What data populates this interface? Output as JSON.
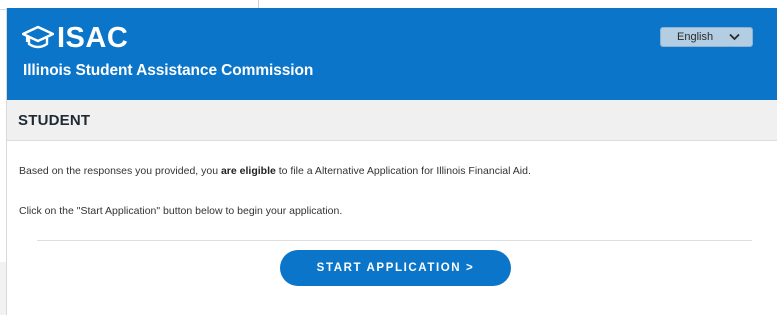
{
  "header": {
    "logo_text": "ISAC",
    "org_name": "Illinois Student Assistance Commission",
    "language_selected": "English",
    "brand_color": "#0b75c9"
  },
  "section": {
    "title": "STUDENT"
  },
  "message": {
    "line1_prefix": "Based on the responses you provided, you ",
    "line1_bold": "are eligible",
    "line1_suffix": " to file a Alternative Application for Illinois Financial Aid.",
    "line2": "Click on the \"Start Application\" button below to begin your application."
  },
  "actions": {
    "start_label": "START APPLICATION >"
  },
  "icons": {
    "logo": "graduation-cap-icon",
    "dropdown": "chevron-down-icon"
  }
}
